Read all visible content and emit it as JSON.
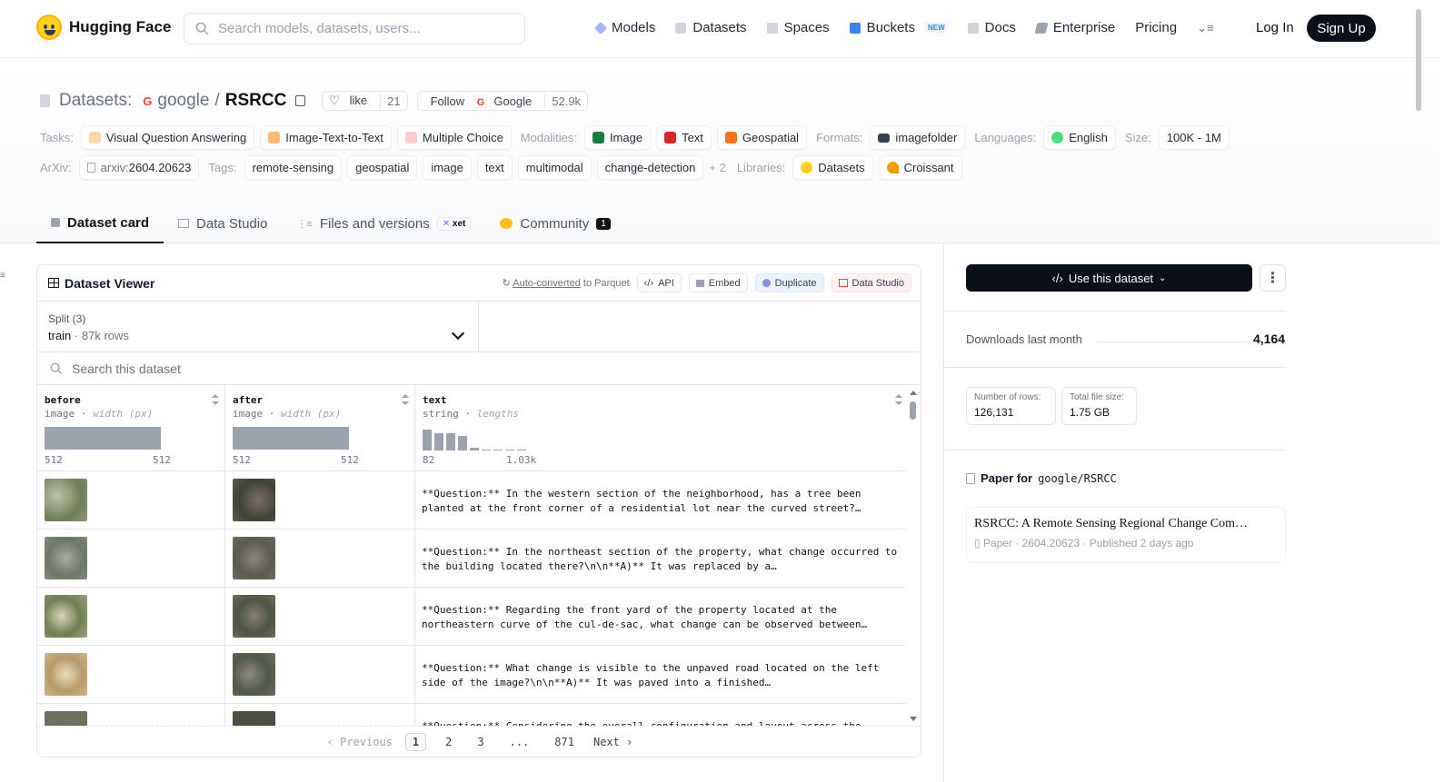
{
  "header": {
    "brand": "Hugging Face",
    "search_placeholder": "Search models, datasets, users...",
    "nav": [
      "Models",
      "Datasets",
      "Spaces",
      "Buckets",
      "Docs",
      "Enterprise",
      "Pricing"
    ],
    "buckets_badge": "NEW",
    "login": "Log In",
    "signup": "Sign Up"
  },
  "repo": {
    "category": "Datasets:",
    "org": "google",
    "sep": "/",
    "name": "RSRCC",
    "like_label": "like",
    "like_count": "21",
    "follow_label": "Follow",
    "follow_org": "Google",
    "followers": "52.9k"
  },
  "tags_row1": {
    "tasks_label": "Tasks:",
    "tasks": [
      "Visual Question Answering",
      "Image-Text-to-Text",
      "Multiple Choice"
    ],
    "modalities_label": "Modalities:",
    "modalities": [
      "Image",
      "Text",
      "Geospatial"
    ],
    "formats_label": "Formats:",
    "formats": [
      "imagefolder"
    ],
    "languages_label": "Languages:",
    "languages": [
      "English"
    ],
    "size_label": "Size:",
    "size": "100K - 1M"
  },
  "tags_row2": {
    "arxiv_label": "ArXiv:",
    "arxiv_prefix": "arxiv:",
    "arxiv_id": "2604.20623",
    "tags_label": "Tags:",
    "tags": [
      "remote-sensing",
      "geospatial",
      "image",
      "text",
      "multimodal",
      "change-detection"
    ],
    "more": "+ 2",
    "libraries_label": "Libraries:",
    "libraries": [
      "Datasets",
      "Croissant"
    ]
  },
  "tabs": [
    {
      "label": "Dataset card"
    },
    {
      "label": "Data Studio"
    },
    {
      "label": "Files and versions",
      "badge": "xet"
    },
    {
      "label": "Community",
      "badge": "1"
    }
  ],
  "viewer": {
    "title": "Dataset Viewer",
    "auto_converted": "Auto-converted",
    "to_parquet": "to Parquet",
    "buttons": [
      "API",
      "Embed",
      "Duplicate",
      "Data Studio"
    ],
    "split_label": "Split (3)",
    "split_value": "train",
    "split_rows": "87k rows",
    "search_placeholder": "Search this dataset",
    "columns": [
      {
        "name": "before",
        "type": "image",
        "stat": "width (px)",
        "min": "512",
        "max": "512"
      },
      {
        "name": "after",
        "type": "image",
        "stat": "width (px)",
        "min": "512",
        "max": "512"
      },
      {
        "name": "text",
        "type": "string",
        "stat": "lengths",
        "min": "82",
        "max": "1.03k"
      }
    ],
    "text_hist": [
      0.95,
      0.8,
      0.8,
      0.65,
      0.12,
      0.05,
      0.0,
      0.0,
      0.05
    ],
    "rows": [
      "**Question:** In the western section of the neighborhood, has a tree been planted at the front corner of a residential lot near the curved street?…",
      "**Question:** In the northeast section of the property, what change occurred to the building located there?\\n\\n**A)** It was replaced by a…",
      "**Question:** Regarding the front yard of the property located at the northeastern curve of the cul-de-sac, what change can be observed between…",
      "**Question:** What change is visible to the unpaved road located on the left side of the image?\\n\\n**A)** It was paved into a finished…",
      "**Question:** Considering the overall configuration and layout across the"
    ],
    "pager": {
      "prev": "Previous",
      "pages": [
        "1",
        "2",
        "3",
        "...",
        "871"
      ],
      "next": "Next"
    }
  },
  "sidebar": {
    "use_button": "Use this dataset",
    "downloads_label": "Downloads last month",
    "downloads_value": "4,164",
    "rows_label": "Number of rows:",
    "rows_value": "126,131",
    "size_label": "Total file size:",
    "size_value": "1.75 GB",
    "paper_for": "Paper for",
    "paper_repo": "google/RSRCC",
    "paper_title": "RSRCC: A Remote Sensing Regional Change Com…",
    "paper_kind": "Paper",
    "paper_id": "2604.20623",
    "paper_published": "Published 2 days ago"
  },
  "colors": {
    "accent": "#0b0f19",
    "brand": "#ffd21e"
  }
}
